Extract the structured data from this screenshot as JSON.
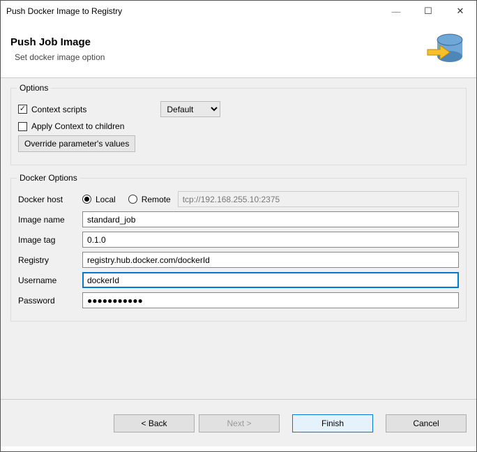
{
  "window": {
    "title": "Push Docker Image to Registry"
  },
  "header": {
    "title": "Push Job Image",
    "subtitle": "Set docker image option"
  },
  "options": {
    "legend": "Options",
    "context_scripts_label": "Context scripts",
    "context_scripts_checked": true,
    "combo_value": "Default",
    "apply_children_label": "Apply Context to children",
    "apply_children_checked": false,
    "override_button": "Override parameter's values"
  },
  "docker": {
    "legend": "Docker Options",
    "host_label": "Docker host",
    "local_label": "Local",
    "remote_label": "Remote",
    "host_selected": "local",
    "remote_url": "tcp://192.168.255.10:2375",
    "image_name_label": "Image name",
    "image_name": "standard_job",
    "image_tag_label": "Image tag",
    "image_tag": "0.1.0",
    "registry_label": "Registry",
    "registry": "registry.hub.docker.com/dockerId",
    "username_label": "Username",
    "username": "dockerId",
    "password_label": "Password",
    "password_mask": "●●●●●●●●●●●"
  },
  "wizard": {
    "back": "< Back",
    "next": "Next >",
    "finish": "Finish",
    "cancel": "Cancel"
  }
}
